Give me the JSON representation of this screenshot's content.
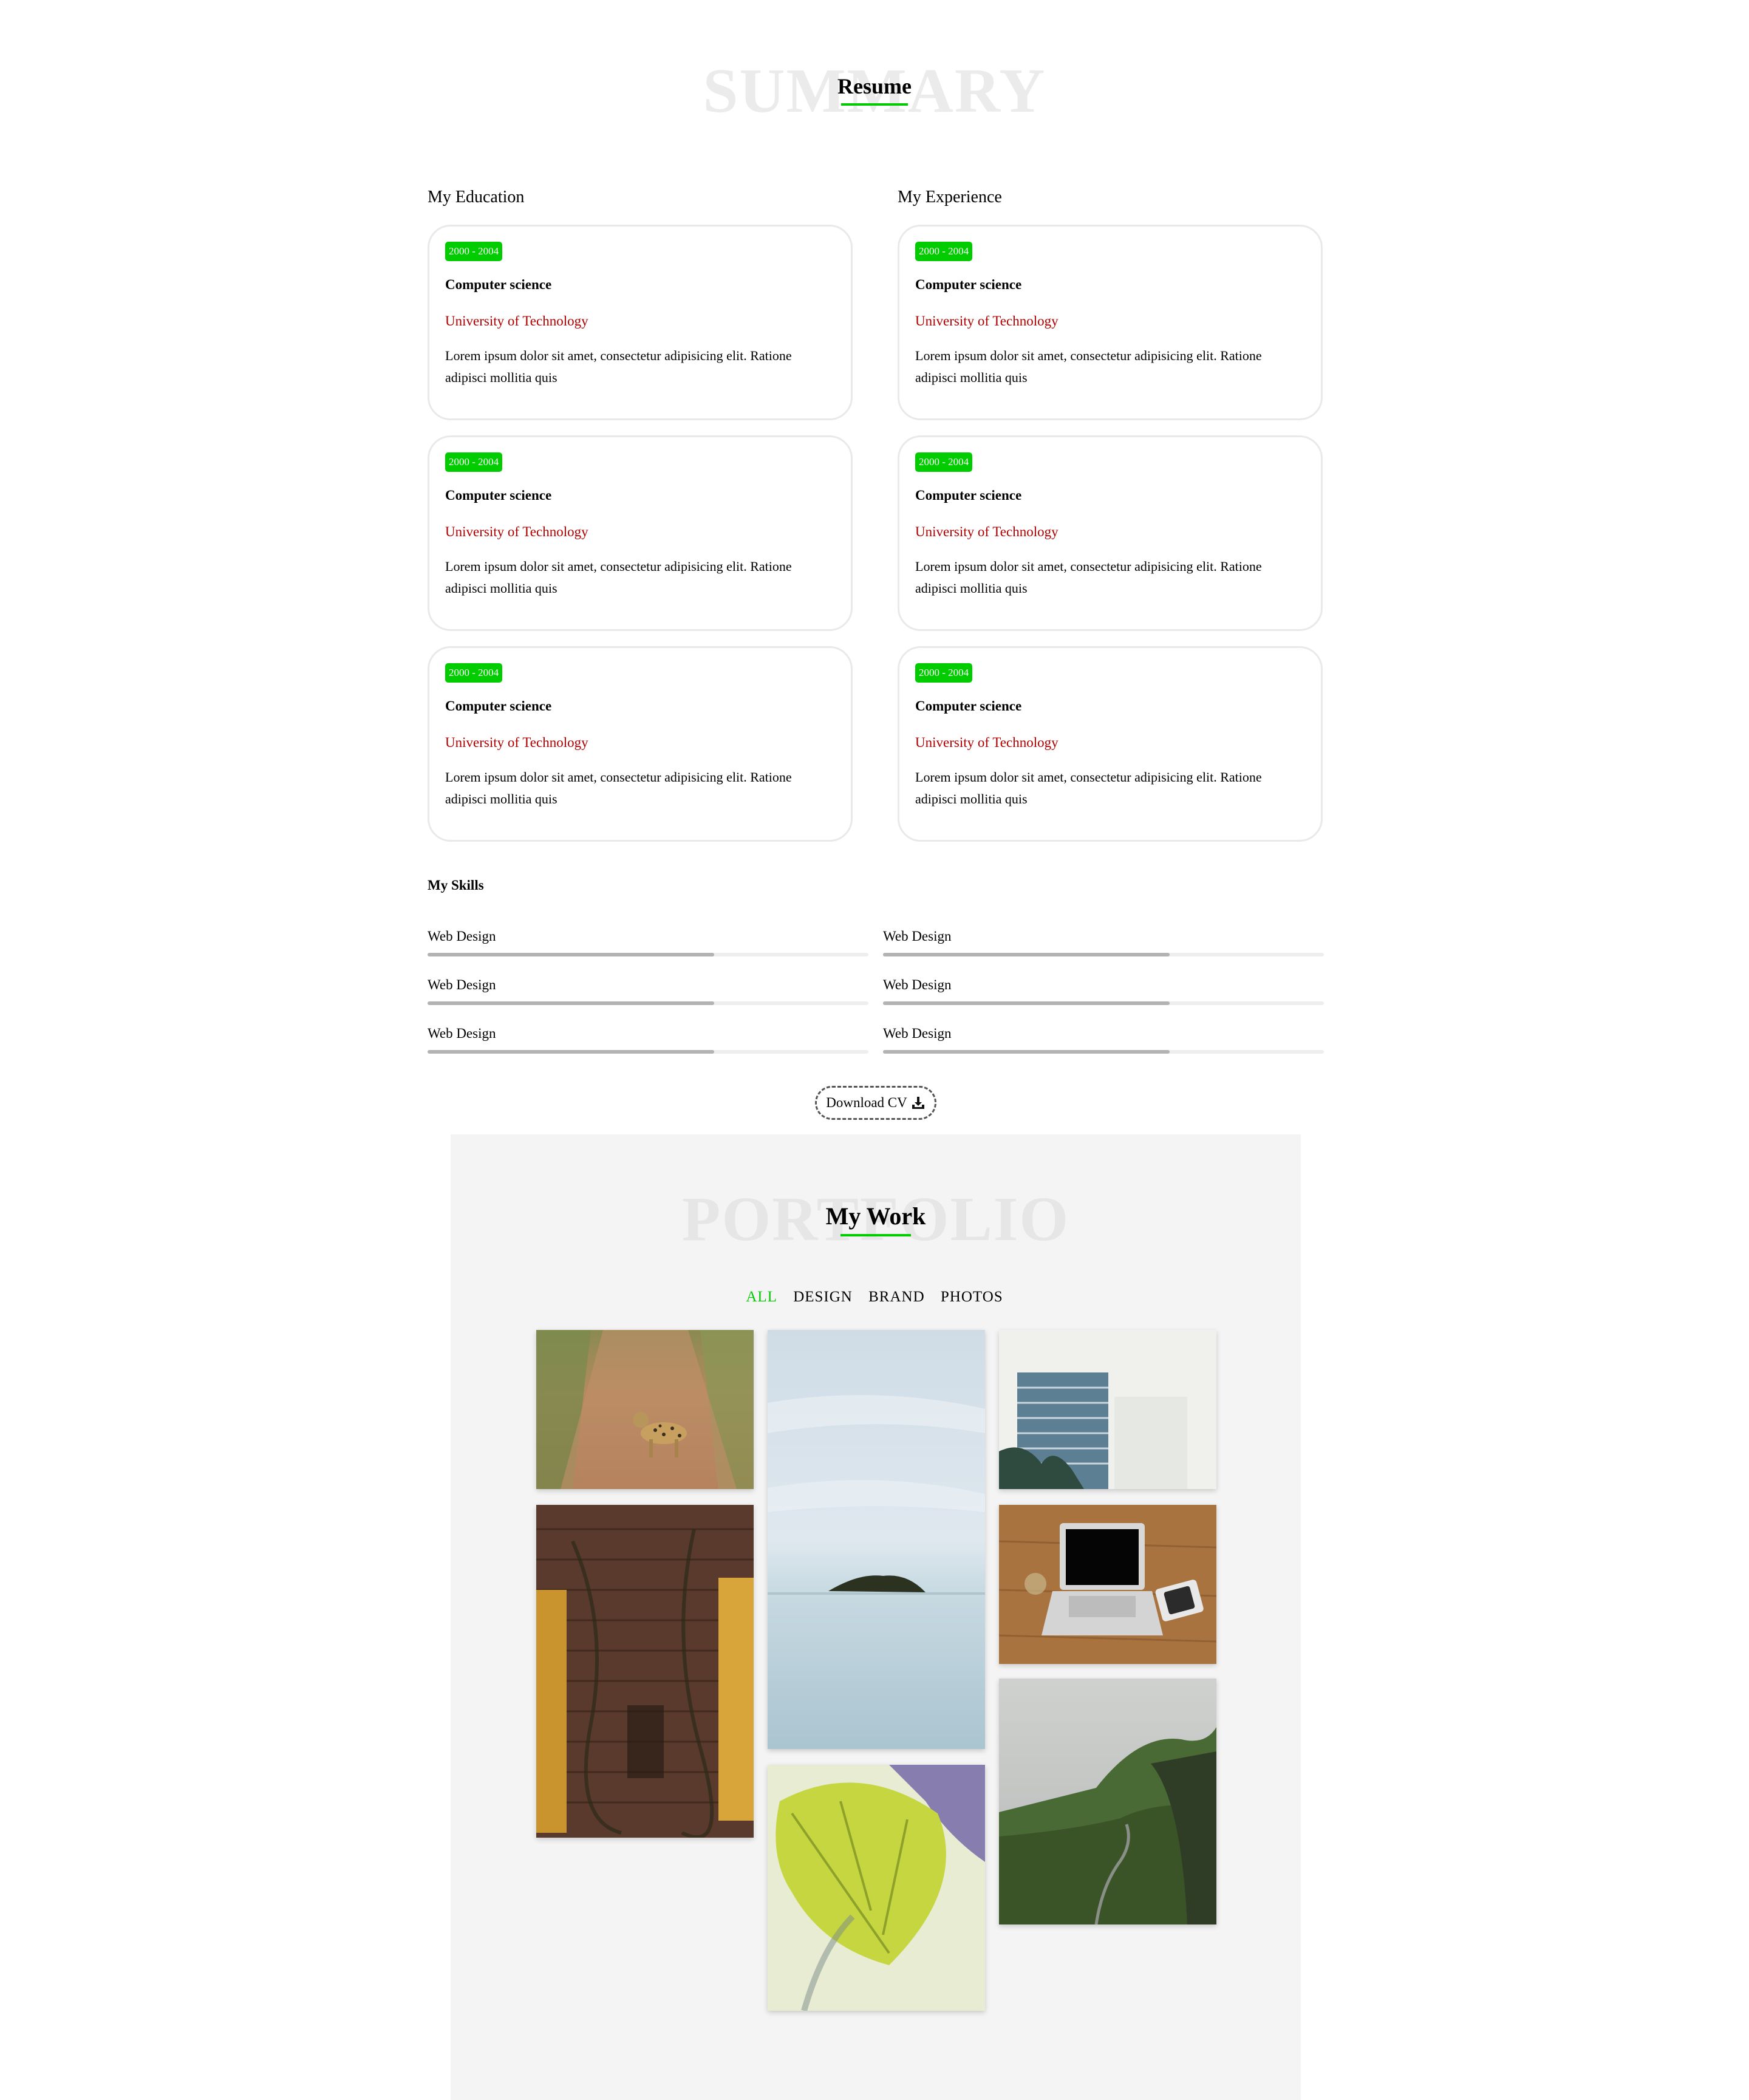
{
  "resume": {
    "bg_word": "SUMMARY",
    "title": "Resume"
  },
  "education": {
    "heading": "My Education",
    "items": [
      {
        "years": "2000 - 2004",
        "title": "Computer science",
        "school": "University of Technology",
        "desc": "Lorem ipsum dolor sit amet, consectetur adipisicing elit. Ratione adipisci mollitia quis"
      },
      {
        "years": "2000 - 2004",
        "title": "Computer science",
        "school": "University of Technology",
        "desc": "Lorem ipsum dolor sit amet, consectetur adipisicing elit. Ratione adipisci mollitia quis"
      },
      {
        "years": "2000 - 2004",
        "title": "Computer science",
        "school": "University of Technology",
        "desc": "Lorem ipsum dolor sit amet, consectetur adipisicing elit. Ratione adipisci mollitia quis"
      }
    ]
  },
  "experience": {
    "heading": "My Experience",
    "items": [
      {
        "years": "2000 - 2004",
        "title": "Computer science",
        "school": "University of Technology",
        "desc": "Lorem ipsum dolor sit amet, consectetur adipisicing elit. Ratione adipisci mollitia quis"
      },
      {
        "years": "2000 - 2004",
        "title": "Computer science",
        "school": "University of Technology",
        "desc": "Lorem ipsum dolor sit amet, consectetur adipisicing elit. Ratione adipisci mollitia quis"
      },
      {
        "years": "2000 - 2004",
        "title": "Computer science",
        "school": "University of Technology",
        "desc": "Lorem ipsum dolor sit amet, consectetur adipisicing elit. Ratione adipisci mollitia quis"
      }
    ]
  },
  "skills": {
    "heading": "My Skills",
    "items": [
      {
        "label": "Web Design",
        "level": 0.65
      },
      {
        "label": "Web Design",
        "level": 0.65
      },
      {
        "label": "Web Design",
        "level": 0.65
      },
      {
        "label": "Web Design",
        "level": 0.65
      },
      {
        "label": "Web Design",
        "level": 0.65
      },
      {
        "label": "Web Design",
        "level": 0.65
      }
    ]
  },
  "download": {
    "label": "Download CV",
    "icon": "download-icon"
  },
  "portfolio": {
    "bg_word": "PORTFOLIO",
    "title": "My Work",
    "filters": [
      {
        "label": "ALL",
        "active": true
      },
      {
        "label": "DESIGN",
        "active": false
      },
      {
        "label": "BRAND",
        "active": false
      },
      {
        "label": "PHOTOS",
        "active": false
      }
    ],
    "photos": [
      "leopard-photo",
      "brick-wall-photo",
      "island-photo",
      "leaf-photo",
      "building-photo",
      "laptop-photo",
      "mountain-photo"
    ]
  },
  "colors": {
    "accent": "#00cc00",
    "school": "#b00000",
    "portfolio_bg": "#f4f4f4",
    "skill_fill": "#b3b3b3",
    "skill_track": "#eeeeee"
  }
}
